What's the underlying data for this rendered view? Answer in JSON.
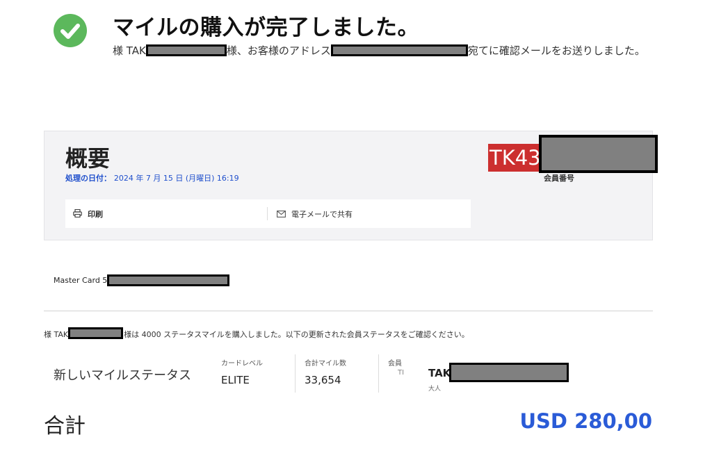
{
  "header": {
    "icon": "check-circle-icon",
    "icon_color": "#5cb85c",
    "title": "マイルの購入が完了しました。",
    "notice_prefix": "様 TAK",
    "notice_middle": "様、お客様のアドレス",
    "notice_suffix": "宛てに確認メールをお送りしました。"
  },
  "summary": {
    "heading": "概要",
    "processed_label": "処理の日付：",
    "processed_value": "2024 年 7 月 15 日 (月曜日) 16:19",
    "member_code": "TK43",
    "member_code_color": "#cc2f2f",
    "member_label": "会員番号",
    "actions": {
      "print_label": "印刷",
      "email_label": "電子メールで共有"
    }
  },
  "payment": {
    "card": "Master Card 54"
  },
  "purchase": {
    "prefix": "様 TAK",
    "suffix": "様は 4000 ステータスマイルを購入しました。以下の更新された会員ステータスをご確認ください。"
  },
  "status": {
    "label": "新しいマイルステータス",
    "card_level_label": "カードレベル",
    "card_level_value": "ELITE",
    "total_miles_label": "合計マイル数",
    "total_miles_value": "33,654",
    "member_label": "会員",
    "member_initial": "TI",
    "member_name": "TAK",
    "member_type": "大人"
  },
  "total": {
    "label": "合計",
    "amount": "USD 280,00",
    "amount_color": "#2a5bd7"
  }
}
